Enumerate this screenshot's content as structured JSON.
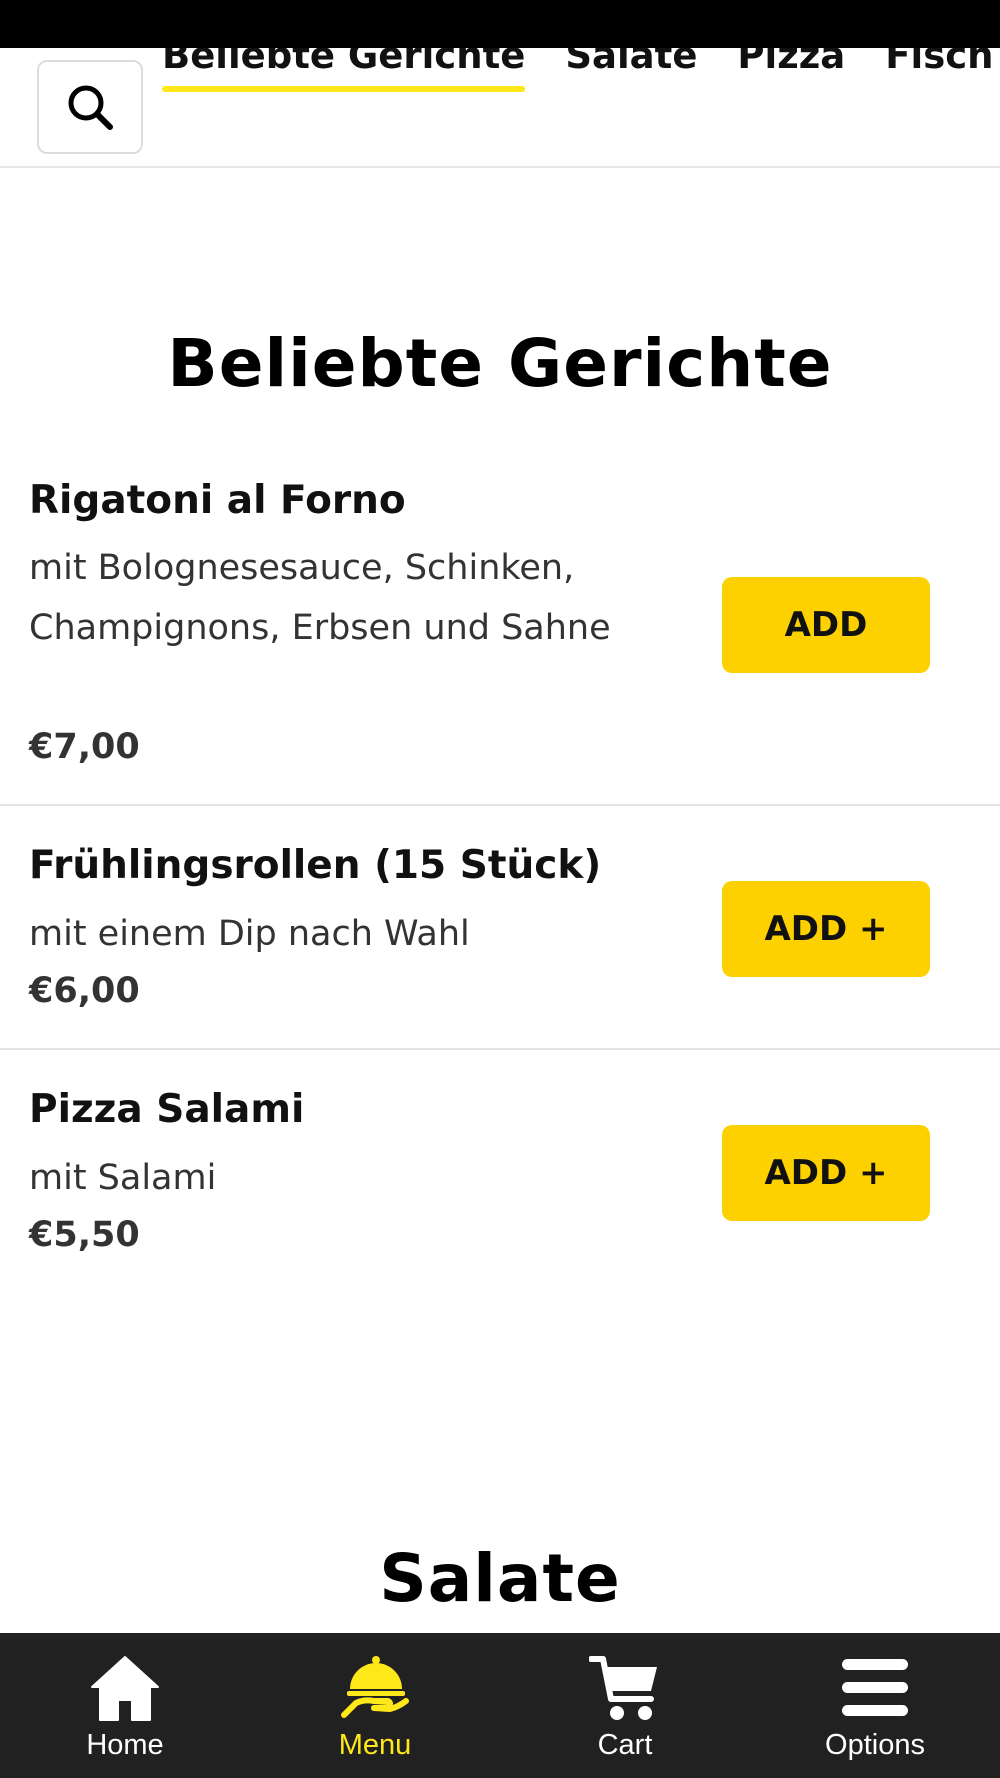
{
  "colors": {
    "accent": "#fdd000",
    "tab_underline": "#ffe81a",
    "nav_background": "#212121",
    "nav_active": "#ffe81a"
  },
  "top_bar": {
    "search_icon": "search-icon",
    "tabs": [
      {
        "label": "Beliebte Gerichte",
        "active": true
      },
      {
        "label": "Salate",
        "active": false
      },
      {
        "label": "Pizza",
        "active": false
      },
      {
        "label": "Fisch sp",
        "active": false
      }
    ]
  },
  "sections": [
    {
      "title": "Beliebte Gerichte",
      "items": [
        {
          "name": "Rigatoni al Forno",
          "description": "mit Bolognesesauce, Schinken, Champignons, Erbsen und Sahne",
          "price": "€7,00",
          "button": "ADD"
        },
        {
          "name": "Frühlingsrollen (15 Stück)",
          "description": "mit einem Dip nach Wahl",
          "price": "€6,00",
          "button": "ADD +"
        },
        {
          "name": "Pizza Salami",
          "description": "mit Salami",
          "price": "€5,50",
          "button": "ADD +"
        }
      ]
    },
    {
      "title": "Salate",
      "items": []
    }
  ],
  "bottom_nav": [
    {
      "label": "Home",
      "icon": "home-icon",
      "active": false
    },
    {
      "label": "Menu",
      "icon": "menu-cloche-icon",
      "active": true
    },
    {
      "label": "Cart",
      "icon": "cart-icon",
      "active": false
    },
    {
      "label": "Options",
      "icon": "hamburger-icon",
      "active": false
    }
  ]
}
